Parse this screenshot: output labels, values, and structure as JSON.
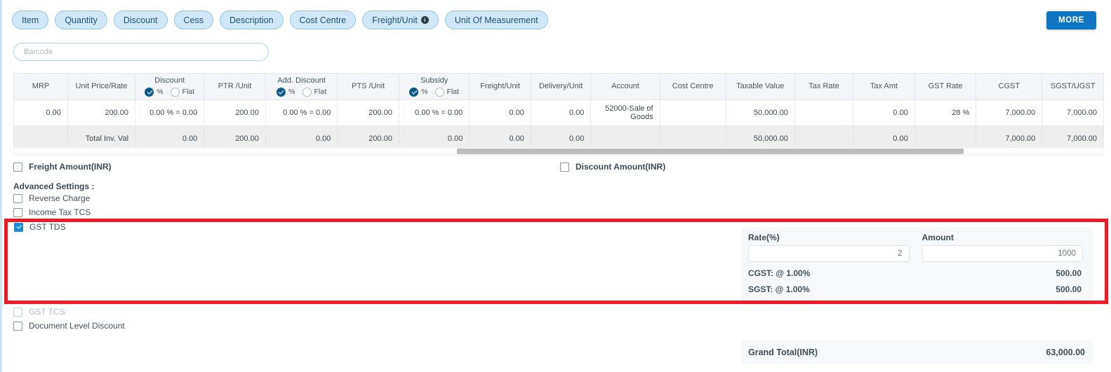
{
  "chips": [
    {
      "label": "Item",
      "has_info": false
    },
    {
      "label": "Quantity",
      "has_info": false
    },
    {
      "label": "Discount",
      "has_info": false
    },
    {
      "label": "Cess",
      "has_info": false
    },
    {
      "label": "Description",
      "has_info": false
    },
    {
      "label": "Cost Centre",
      "has_info": false
    },
    {
      "label": "Freight/Unit",
      "has_info": true
    },
    {
      "label": "Unit Of Measurement",
      "has_info": false
    }
  ],
  "toolbar": {
    "more_label": "MORE",
    "accent": "#1176c1"
  },
  "search": {
    "barcode_placeholder": "Barcode",
    "barcode_value": ""
  },
  "table": {
    "columns": [
      {
        "title": "MRP",
        "radio": null
      },
      {
        "title": "Unit Price/Rate",
        "radio": null
      },
      {
        "title": "Discount",
        "radio": {
          "on": "%",
          "off": "Flat"
        }
      },
      {
        "title": "PTR /Unit",
        "radio": null
      },
      {
        "title": "Add. Discount",
        "radio": {
          "on": "%",
          "off": "Flat"
        }
      },
      {
        "title": "PTS /Unit",
        "radio": null
      },
      {
        "title": "Subsidy",
        "radio": {
          "on": "%",
          "off": "Flat"
        }
      },
      {
        "title": "Freight/Unit",
        "radio": null
      },
      {
        "title": "Delivery/Unit",
        "radio": null
      },
      {
        "title": "Account",
        "radio": null
      },
      {
        "title": "Cost Centre",
        "radio": null
      },
      {
        "title": "Taxable Value",
        "radio": null
      },
      {
        "title": "Tax Rate",
        "radio": null
      },
      {
        "title": "Tax Amt",
        "radio": null
      },
      {
        "title": "GST Rate",
        "radio": null
      },
      {
        "title": "CGST",
        "radio": null
      },
      {
        "title": "SGST/UGST",
        "radio": null
      }
    ],
    "row": {
      "mrp": "0.00",
      "unit_price": "200.00",
      "discount": "0.00 % = 0.00",
      "ptr_unit": "200.00",
      "add_discount": "0.00 % = 0.00",
      "pts_unit": "200.00",
      "subsidy": "0.00 % = 0.00",
      "freight_unit": "0.00",
      "delivery_unit": "0.00",
      "account": "52000-Sale of Goods",
      "cost_centre": "",
      "taxable_value": "50,000.00",
      "tax_rate": "",
      "tax_amt": "0.00",
      "gst_rate": "28 %",
      "cgst": "7,000.00",
      "sgst": "7,000.00"
    },
    "total": {
      "label": "Total Inv. Val",
      "discount": "0.00",
      "ptr_unit": "200.00",
      "add_discount": "0.00",
      "pts_unit": "200.00",
      "subsidy": "0.00",
      "freight_unit": "0.00",
      "delivery_unit": "0.00",
      "taxable_value": "50,000.00",
      "tax_amt": "0.00",
      "cgst": "7,000.00",
      "sgst": "7,000.00"
    }
  },
  "options": {
    "freight_amount": {
      "label": "Freight Amount(INR)",
      "checked": false
    },
    "discount_amount": {
      "label": "Discount Amount(INR)",
      "checked": false
    },
    "advanced_label": "Advanced Settings :",
    "reverse_charge": {
      "label": "Reverse Charge",
      "checked": false
    },
    "income_tax_tcs": {
      "label": "Income Tax TCS",
      "checked": false
    },
    "gst_tds": {
      "label": "GST TDS",
      "checked": true
    },
    "gst_tcs": {
      "label": "GST TCS",
      "checked": false,
      "disabled": true
    },
    "doc_level_discount": {
      "label": "Document Level Discount",
      "checked": false
    }
  },
  "gst_tds_panel": {
    "rate_label": "Rate(%)",
    "rate_value": "2",
    "amount_label": "Amount",
    "amount_value": "1000",
    "cgst_label": "CGST: @ 1.00%",
    "cgst_value": "500.00",
    "sgst_label": "SGST: @ 1.00%",
    "sgst_value": "500.00"
  },
  "grand_total": {
    "label": "Grand Total(INR)",
    "value": "63,000.00"
  },
  "highlight": {
    "color": "#ec1c24"
  }
}
